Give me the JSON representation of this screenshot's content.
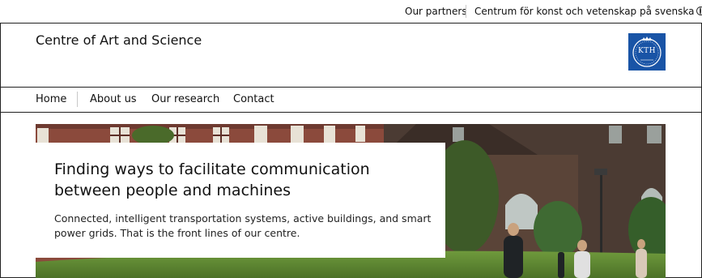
{
  "topbar": {
    "partners_label": "Our partners",
    "language_label": "Centrum för konst och vetenskap på svenska"
  },
  "header": {
    "site_title": "Centre of Art and Science",
    "logo_text": "KTH"
  },
  "nav": {
    "items": [
      {
        "label": "Home"
      },
      {
        "label": "About us"
      },
      {
        "label": "Our research"
      },
      {
        "label": "Contact"
      }
    ]
  },
  "hero": {
    "title": "Finding ways to facilitate communication between people and machines",
    "text": "Connected, intelligent transportation systems, active buildings, and smart power grids. That is the front lines of our centre."
  },
  "colors": {
    "logo_blue": "#1954a6",
    "border": "#222222",
    "separator": "#c8c8c8"
  },
  "icons": {
    "language": "globe-icon"
  }
}
